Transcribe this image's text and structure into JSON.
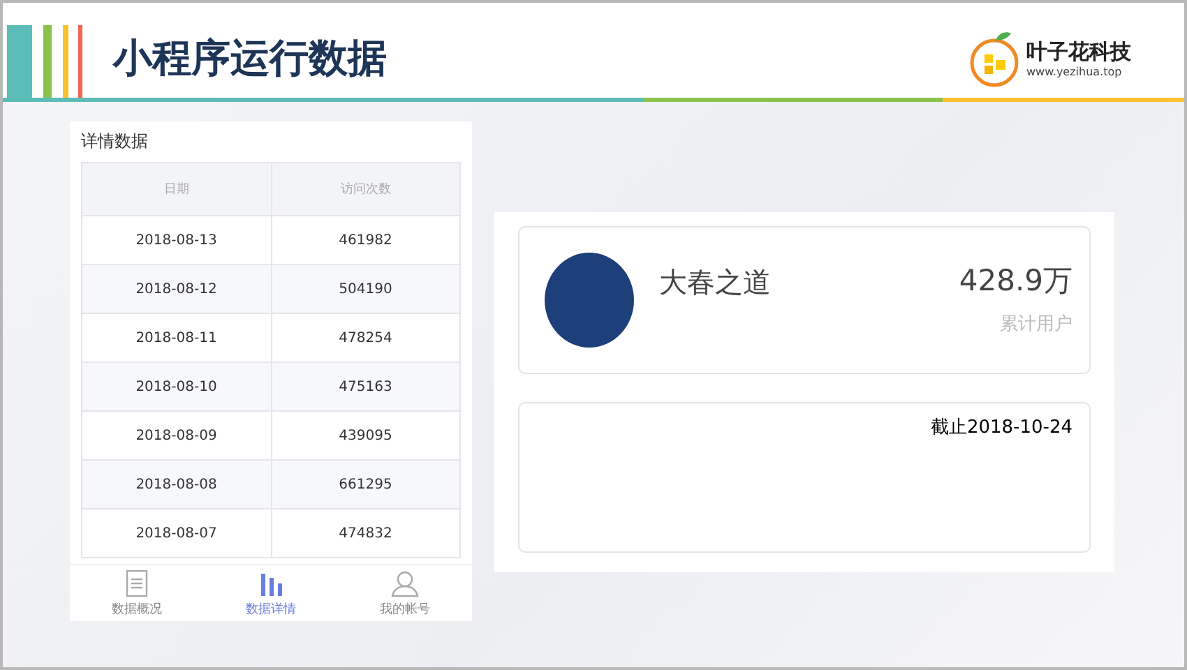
{
  "slide": {
    "title": "小程序运行数据",
    "logo": {
      "name": "叶子花科技",
      "url": "www.yezihua.top"
    }
  },
  "detail": {
    "heading": "详情数据",
    "columns": [
      "日期",
      "访问次数"
    ],
    "rows": [
      [
        "2018-08-13",
        "461982"
      ],
      [
        "2018-08-12",
        "504190"
      ],
      [
        "2018-08-11",
        "478254"
      ],
      [
        "2018-08-10",
        "475163"
      ],
      [
        "2018-08-09",
        "439095"
      ],
      [
        "2018-08-08",
        "661295"
      ],
      [
        "2018-08-07",
        "474832"
      ]
    ],
    "tabs": [
      {
        "label": "数据概况",
        "kind": "list",
        "selected": false
      },
      {
        "label": "数据详情",
        "kind": "bars",
        "selected": true
      },
      {
        "label": "我的帐号",
        "kind": "person",
        "selected": false
      }
    ]
  },
  "profile": {
    "name": "大春之道",
    "total": "428.9万",
    "total_label": "累计用户",
    "note": "截止2018-10-24"
  }
}
